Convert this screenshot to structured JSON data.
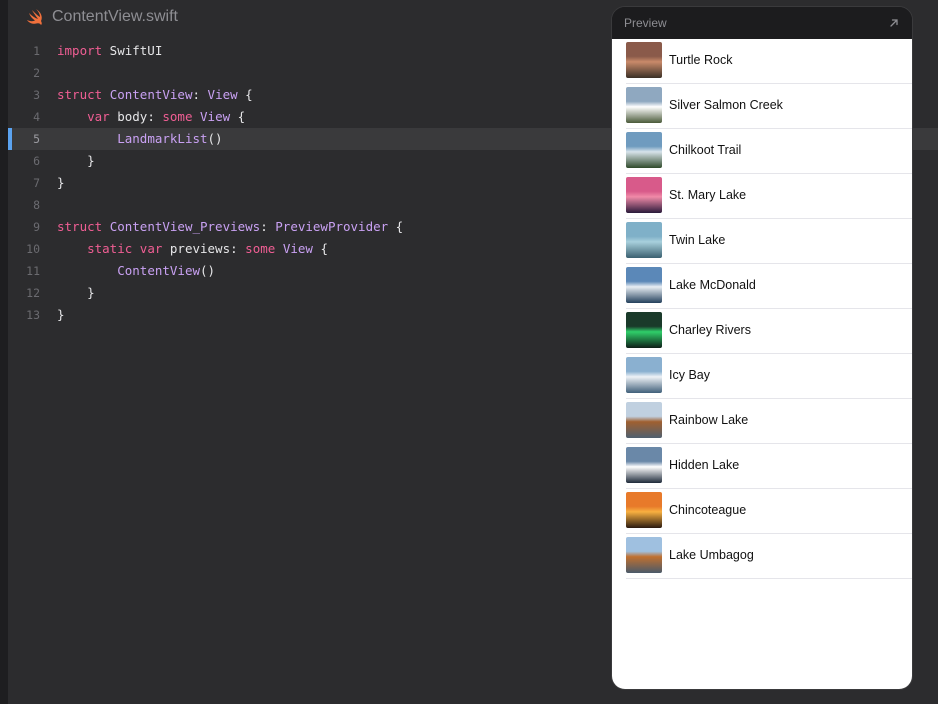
{
  "editor": {
    "file_name": "ContentView.swift",
    "active_line": 5,
    "lines": [
      {
        "num": "1",
        "tokens": [
          {
            "t": "import",
            "c": "kw"
          },
          {
            "t": " SwiftUI",
            "c": "pl"
          }
        ]
      },
      {
        "num": "2",
        "tokens": []
      },
      {
        "num": "3",
        "tokens": [
          {
            "t": "struct",
            "c": "kw"
          },
          {
            "t": " ",
            "c": "pl"
          },
          {
            "t": "ContentView",
            "c": "ty"
          },
          {
            "t": ": ",
            "c": "pl"
          },
          {
            "t": "View",
            "c": "ty"
          },
          {
            "t": " {",
            "c": "pl"
          }
        ]
      },
      {
        "num": "4",
        "tokens": [
          {
            "t": "    ",
            "c": "pl"
          },
          {
            "t": "var",
            "c": "kw"
          },
          {
            "t": " body: ",
            "c": "pl"
          },
          {
            "t": "some",
            "c": "kw"
          },
          {
            "t": " ",
            "c": "pl"
          },
          {
            "t": "View",
            "c": "ty"
          },
          {
            "t": " {",
            "c": "pl"
          }
        ]
      },
      {
        "num": "5",
        "tokens": [
          {
            "t": "        ",
            "c": "pl"
          },
          {
            "t": "LandmarkList",
            "c": "ty"
          },
          {
            "t": "()",
            "c": "pl"
          }
        ]
      },
      {
        "num": "6",
        "tokens": [
          {
            "t": "    }",
            "c": "pl"
          }
        ]
      },
      {
        "num": "7",
        "tokens": [
          {
            "t": "}",
            "c": "pl"
          }
        ]
      },
      {
        "num": "8",
        "tokens": []
      },
      {
        "num": "9",
        "tokens": [
          {
            "t": "struct",
            "c": "kw"
          },
          {
            "t": " ",
            "c": "pl"
          },
          {
            "t": "ContentView_Previews",
            "c": "ty"
          },
          {
            "t": ": ",
            "c": "pl"
          },
          {
            "t": "PreviewProvider",
            "c": "ty"
          },
          {
            "t": " {",
            "c": "pl"
          }
        ]
      },
      {
        "num": "10",
        "tokens": [
          {
            "t": "    ",
            "c": "pl"
          },
          {
            "t": "static",
            "c": "kw"
          },
          {
            "t": " ",
            "c": "pl"
          },
          {
            "t": "var",
            "c": "kw"
          },
          {
            "t": " previews: ",
            "c": "pl"
          },
          {
            "t": "some",
            "c": "kw"
          },
          {
            "t": " ",
            "c": "pl"
          },
          {
            "t": "View",
            "c": "ty"
          },
          {
            "t": " {",
            "c": "pl"
          }
        ]
      },
      {
        "num": "11",
        "tokens": [
          {
            "t": "        ",
            "c": "pl"
          },
          {
            "t": "ContentView",
            "c": "ty"
          },
          {
            "t": "()",
            "c": "pl"
          }
        ]
      },
      {
        "num": "12",
        "tokens": [
          {
            "t": "    }",
            "c": "pl"
          }
        ]
      },
      {
        "num": "13",
        "tokens": [
          {
            "t": "}",
            "c": "pl"
          }
        ]
      }
    ]
  },
  "preview": {
    "title": "Preview",
    "expand_icon": "arrow-up-right-icon",
    "landmarks": [
      {
        "name": "Turtle Rock",
        "thumb": [
          "#8a5a4a",
          "#c98a6a",
          "#3b3026"
        ]
      },
      {
        "name": "Silver Salmon Creek",
        "thumb": [
          "#8fa8c0",
          "#ffffff",
          "#4a5a3a"
        ]
      },
      {
        "name": "Chilkoot Trail",
        "thumb": [
          "#6f9bbf",
          "#d7e3ea",
          "#2f4a2a"
        ]
      },
      {
        "name": "St. Mary Lake",
        "thumb": [
          "#d85a8a",
          "#f08aa8",
          "#2a1a3a"
        ]
      },
      {
        "name": "Twin Lake",
        "thumb": [
          "#7fb0c8",
          "#a8d0dc",
          "#3a6070"
        ]
      },
      {
        "name": "Lake McDonald",
        "thumb": [
          "#5b88b8",
          "#e8eef4",
          "#24405c"
        ]
      },
      {
        "name": "Charley Rivers",
        "thumb": [
          "#1a3a2a",
          "#2fcf6a",
          "#0e1e18"
        ]
      },
      {
        "name": "Icy Bay",
        "thumb": [
          "#8ab0d0",
          "#eef2f6",
          "#40607a"
        ]
      },
      {
        "name": "Rainbow Lake",
        "thumb": [
          "#c0d0e0",
          "#a06030",
          "#506070"
        ]
      },
      {
        "name": "Hidden Lake",
        "thumb": [
          "#6a88a8",
          "#ffffff",
          "#1e2a3a"
        ]
      },
      {
        "name": "Chincoteague",
        "thumb": [
          "#e87a2a",
          "#f8b040",
          "#2a1a10"
        ]
      },
      {
        "name": "Lake Umbagog",
        "thumb": [
          "#9fc0e0",
          "#c07030",
          "#4a5a6a"
        ]
      }
    ]
  }
}
